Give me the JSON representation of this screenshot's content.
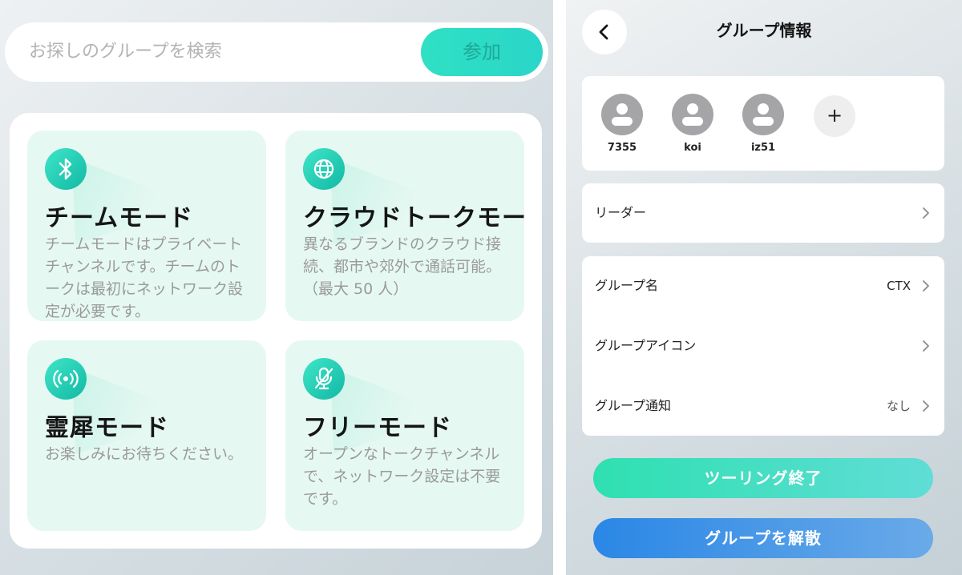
{
  "left": {
    "search": {
      "placeholder": "お探しのグループを検索",
      "join_label": "参加"
    },
    "modes": [
      {
        "title": "チームモード",
        "description": "チームモードはプライベートチャンネルです。チームのトークは最初にネットワーク設定が必要です。",
        "icon": "bluetooth-icon"
      },
      {
        "title": "クラウドトークモー",
        "description": "異なるブランドのクラウド接続、都市や郊外で通話可能。（最大 50 人）",
        "icon": "globe-icon"
      },
      {
        "title": "霊犀モード",
        "description": "お楽しみにお待ちください。",
        "icon": "broadcast-icon"
      },
      {
        "title": "フリーモード",
        "description": "オープンなトークチャンネルで、ネットワーク設定は不要です。",
        "icon": "mic-off-icon"
      }
    ]
  },
  "right": {
    "header": {
      "title": "グループ情報"
    },
    "members": [
      {
        "name": "7355"
      },
      {
        "name": "koi"
      },
      {
        "name": "iz51"
      }
    ],
    "add_member_label": "+",
    "leader": {
      "label": "リーダー"
    },
    "group_name": {
      "label": "グループ名",
      "value": "CTX"
    },
    "group_icon": {
      "label": "グループアイコン"
    },
    "group_notice": {
      "label": "グループ通知",
      "value": "なし"
    },
    "end_touring_label": "ツーリング終了",
    "disband_label": "グループを解散"
  },
  "colors": {
    "accent_teal": "#2fe0c4",
    "danger_blue": "#2a87e6"
  }
}
